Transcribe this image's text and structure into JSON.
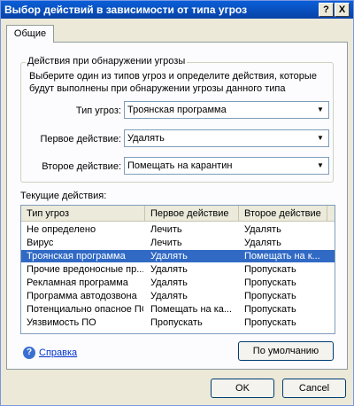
{
  "window": {
    "title": "Выбор действий в зависимости от типа угроз",
    "help_btn": "?",
    "close_btn": "X"
  },
  "tabs": [
    {
      "label": "Общие"
    }
  ],
  "group": {
    "title": "Действия при обнаружении угрозы",
    "description": "Выберите один из типов угроз и определите действия, которые будут выполнены при обнаружении угрозы данного типа",
    "threat_type": {
      "label": "Тип угроз:",
      "value": "Троянская программа"
    },
    "first_action": {
      "label": "Первое действие:",
      "value": "Удалять"
    },
    "second_action": {
      "label": "Второе действие:",
      "value": "Помещать на карантин"
    }
  },
  "current": {
    "label": "Текущие действия:",
    "columns": [
      "Тип угроз",
      "Первое действие",
      "Второе действие"
    ],
    "rows": [
      [
        "Не определено",
        "Лечить",
        "Удалять"
      ],
      [
        "Вирус",
        "Лечить",
        "Удалять"
      ],
      [
        "Троянская программа",
        "Удалять",
        "Помещать на к..."
      ],
      [
        "Прочие вредоносные пр...",
        "Удалять",
        "Пропускать"
      ],
      [
        "Рекламная программа",
        "Удалять",
        "Пропускать"
      ],
      [
        "Программа автодозвона",
        "Удалять",
        "Пропускать"
      ],
      [
        "Потенциально опасное ПО",
        "Помещать на ка...",
        "Пропускать"
      ],
      [
        "Уязвимость ПО",
        "Пропускать",
        "Пропускать"
      ]
    ],
    "selected_index": 2
  },
  "footer": {
    "help_link": "Справка",
    "defaults_button": "По умолчанию",
    "ok_button": "OK",
    "cancel_button": "Cancel"
  }
}
